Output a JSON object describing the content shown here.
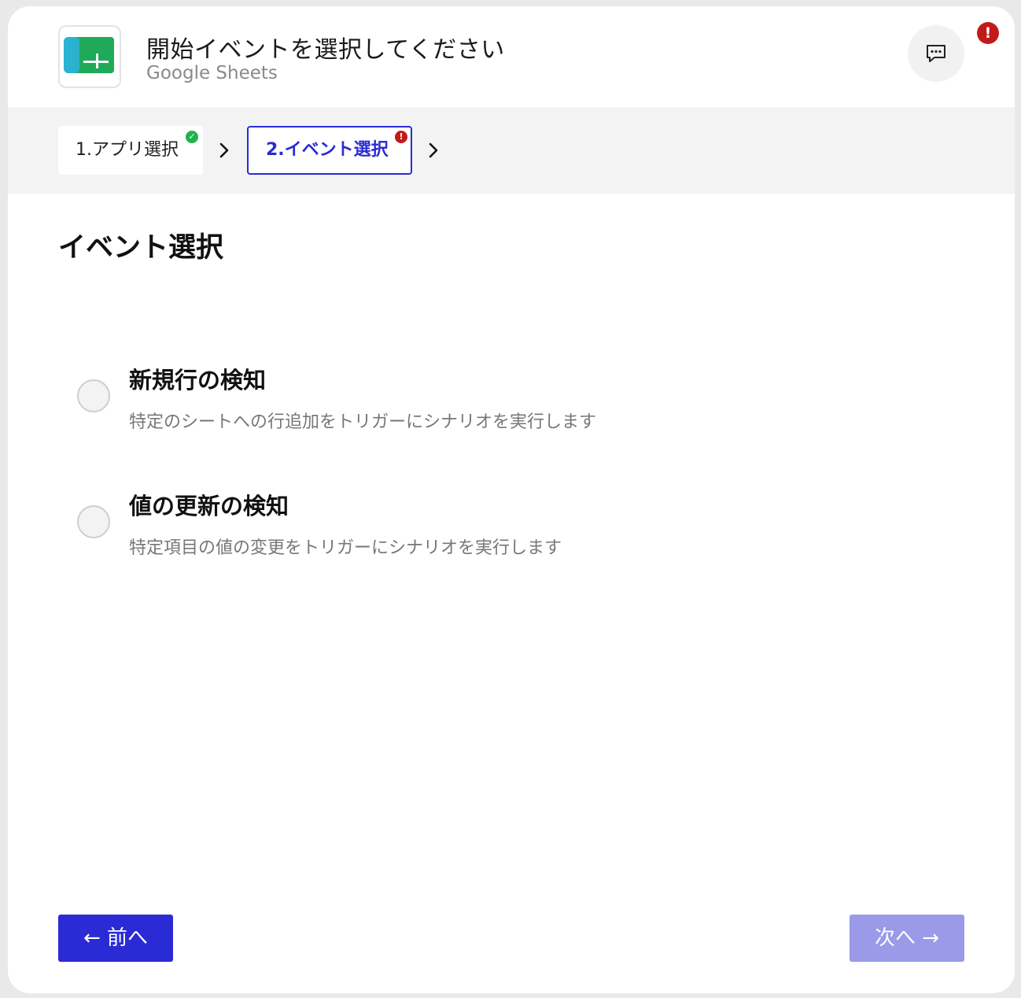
{
  "header": {
    "title": "開始イベントを選択してください",
    "subtitle": "Google Sheets",
    "alert_mark": "!"
  },
  "stepper": {
    "steps": [
      {
        "label": "1.アプリ選択",
        "status": "complete",
        "status_mark": "✓"
      },
      {
        "label": "2.イベント選択",
        "status": "error",
        "status_mark": "!"
      }
    ]
  },
  "main": {
    "section_title": "イベント選択",
    "options": [
      {
        "label": "新規行の検知",
        "description": "特定のシートへの行追加をトリガーにシナリオを実行します",
        "selected": false
      },
      {
        "label": "値の更新の検知",
        "description": "特定項目の値の変更をトリガーにシナリオを実行します",
        "selected": false
      }
    ]
  },
  "footer": {
    "prev_label": "← 前へ",
    "next_label": "次へ →"
  },
  "colors": {
    "primary": "#2b2bd6",
    "primary_disabled": "#9a9ae8",
    "success": "#22b24c",
    "error": "#c21a1a",
    "sheets_green": "#1faa5a"
  },
  "icons": {
    "app": "google-sheets-icon",
    "chat": "chat-bubble-icon",
    "alert": "alert-icon",
    "chevron": "chevron-right-icon"
  }
}
